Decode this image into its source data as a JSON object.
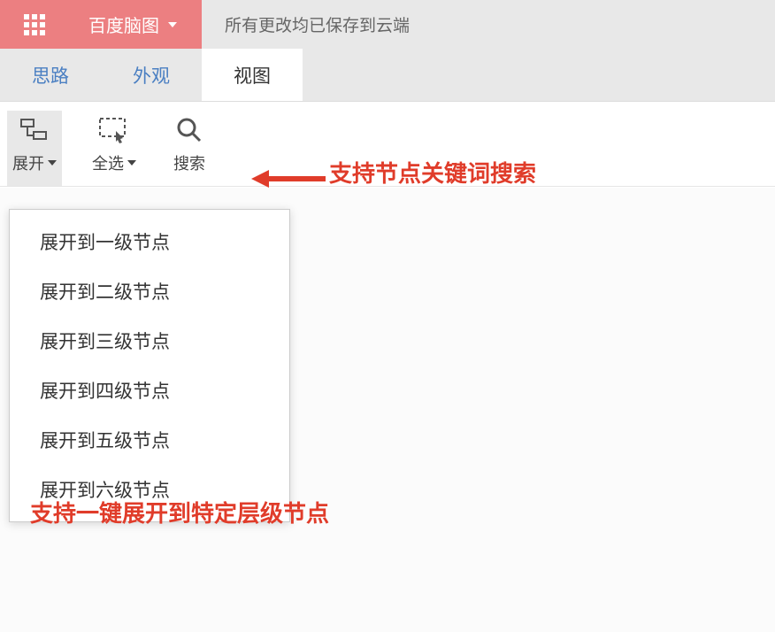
{
  "header": {
    "brand": "百度脑图",
    "status": "所有更改均已保存到云端"
  },
  "tabs": [
    {
      "label": "思路",
      "active": false
    },
    {
      "label": "外观",
      "active": false
    },
    {
      "label": "视图",
      "active": true
    }
  ],
  "toolbar": {
    "expand": {
      "label": "展开",
      "active": true
    },
    "selectAll": {
      "label": "全选"
    },
    "search": {
      "label": "搜索"
    }
  },
  "dropdown": {
    "items": [
      "展开到一级节点",
      "展开到二级节点",
      "展开到三级节点",
      "展开到四级节点",
      "展开到五级节点",
      "展开到六级节点"
    ]
  },
  "annotations": {
    "searchHint": "支持节点关键词搜索",
    "expandHint": "支持一键展开到特定层级节点"
  }
}
